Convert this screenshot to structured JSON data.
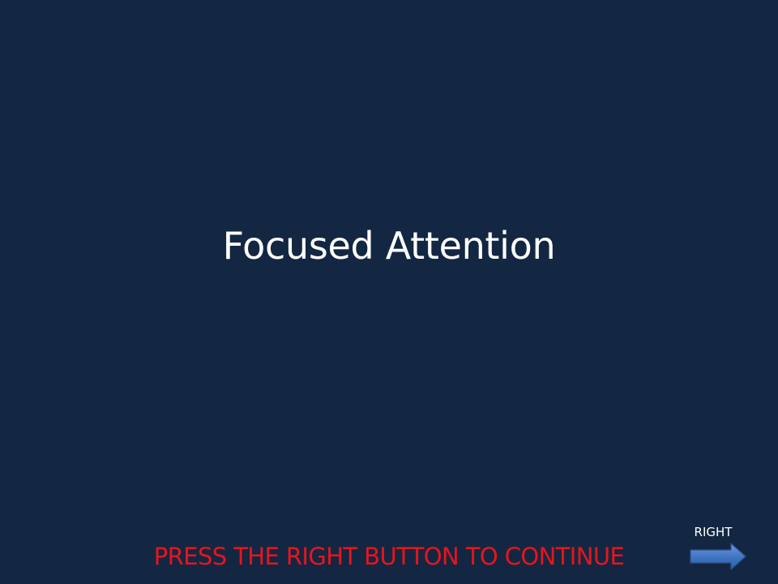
{
  "slide": {
    "title": "Focused Attention",
    "instruction": "PRESS THE RIGHT BUTTON TO CONTINUE"
  },
  "navigation": {
    "right_label": "RIGHT",
    "right_icon": "right-arrow-icon"
  },
  "colors": {
    "background": "#132742",
    "title_text": "#ffffff",
    "instruction_text": "#e8141d",
    "arrow": "#4a7cc5"
  }
}
